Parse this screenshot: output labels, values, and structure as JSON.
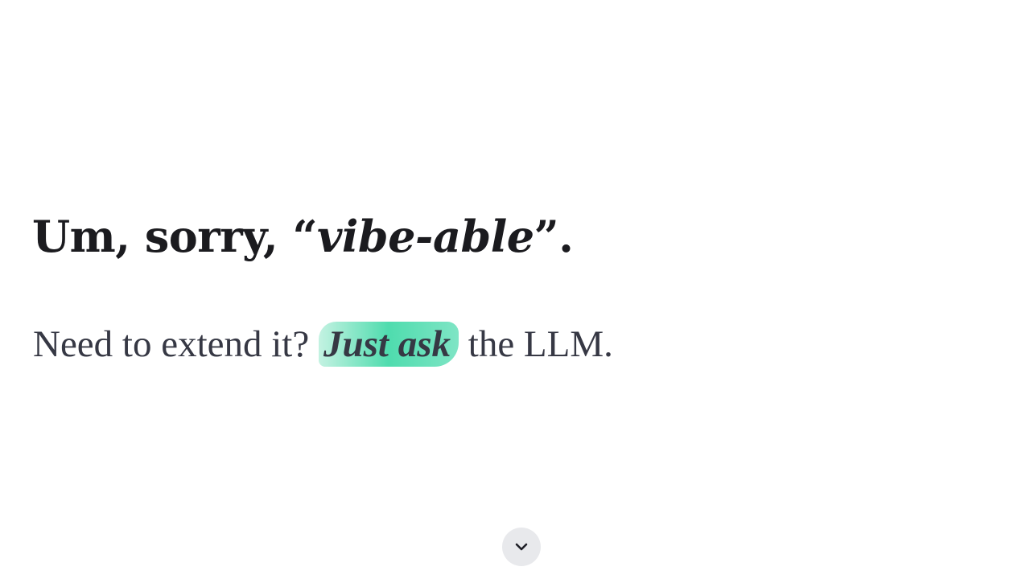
{
  "headline": {
    "prefix": "Um, sorry, “",
    "emphasis": "vibe-able",
    "suffix": "”."
  },
  "subline": {
    "before": "Need to extend it? ",
    "highlight": "Just ask",
    "after": " the LLM."
  },
  "highlight_colors": [
    "#c4f2e2",
    "#4fdcae",
    "#7fe5c5"
  ],
  "scroll_button": {
    "icon": "chevron-down-icon"
  }
}
